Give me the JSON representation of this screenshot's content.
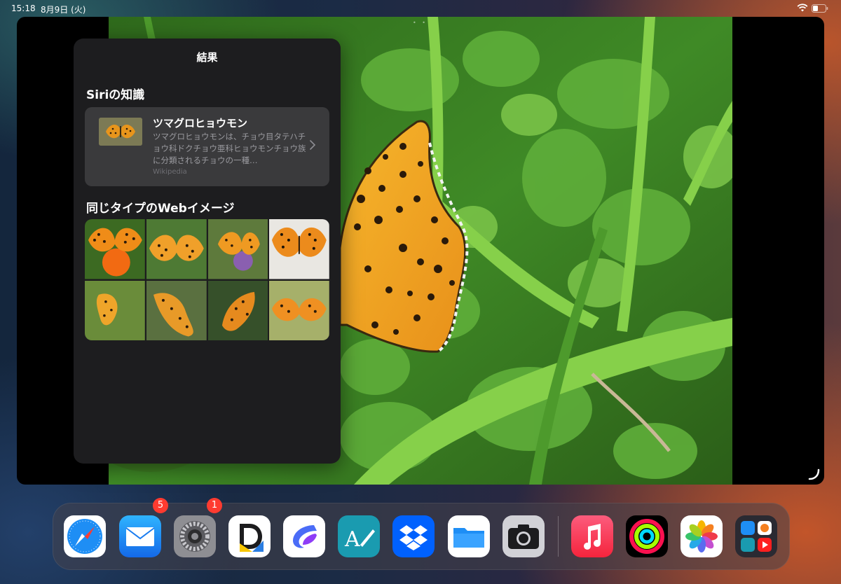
{
  "status_bar": {
    "time": "15:18",
    "date": "8月9日 (火)"
  },
  "lookup_panel": {
    "title": "結果",
    "siri_knowledge": {
      "heading": "Siriの知識",
      "title": "ツマグロヒョウモン",
      "description": "ツマグロヒョウモンは、チョウ目タテハチョウ科ドクチョウ亜科ヒョウモンチョウ族に分類されるチョウの一種…",
      "source": "Wikipedia"
    },
    "similar_images": {
      "heading": "同じタイプのWebイメージ",
      "count": 8
    }
  },
  "dock": {
    "apps": [
      "Safari",
      "Mail",
      "Settings",
      "Documents",
      "Craft",
      "Notes Writer",
      "Dropbox",
      "Files",
      "Camera",
      "Music",
      "Fitness",
      "Photos",
      "App Library"
    ],
    "badges": {
      "mail": "5",
      "settings": "1"
    }
  },
  "colors": {
    "panel_bg": "#1d1d1f",
    "card_bg": "#3a3a3c",
    "badge": "#ff3b30",
    "butterfly": "#f2a31b"
  }
}
